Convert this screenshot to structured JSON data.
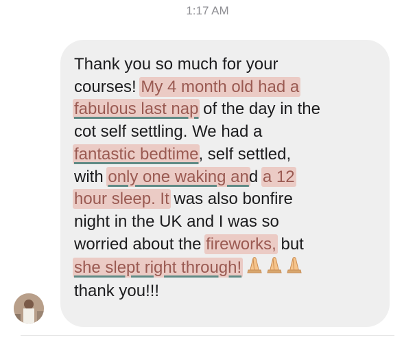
{
  "header": {
    "timestamp": "1:17 AM"
  },
  "message": {
    "line1": "Thank you so much for your",
    "line2_a": "courses! ",
    "line2_b": "My 4 month old had a",
    "line3_a": "fabulous last nap",
    "line3_b": " of the day in the",
    "line4": "cot self settling. We had a",
    "line5_a": "fantastic bedtime",
    "line5_b": ", self settled,",
    "line6_a": "with ",
    "line6_b": "only one waking an",
    "line6_c": "d ",
    "line6_d": "a 12",
    "line7_a": "hour sleep. It",
    "line7_b": " was also bonfire",
    "line8": "night in the UK and I was so",
    "line9_a": "worried about the ",
    "line9_b": "fireworks,",
    "line9_c": " but",
    "line10_a": "she slept right through!",
    "line11": "thank you!!!"
  },
  "emoji": {
    "name": "folded-hands",
    "count": 3
  },
  "colors": {
    "highlight": "#e69687",
    "underline": "#5f8a85",
    "bubble": "#efefef"
  }
}
